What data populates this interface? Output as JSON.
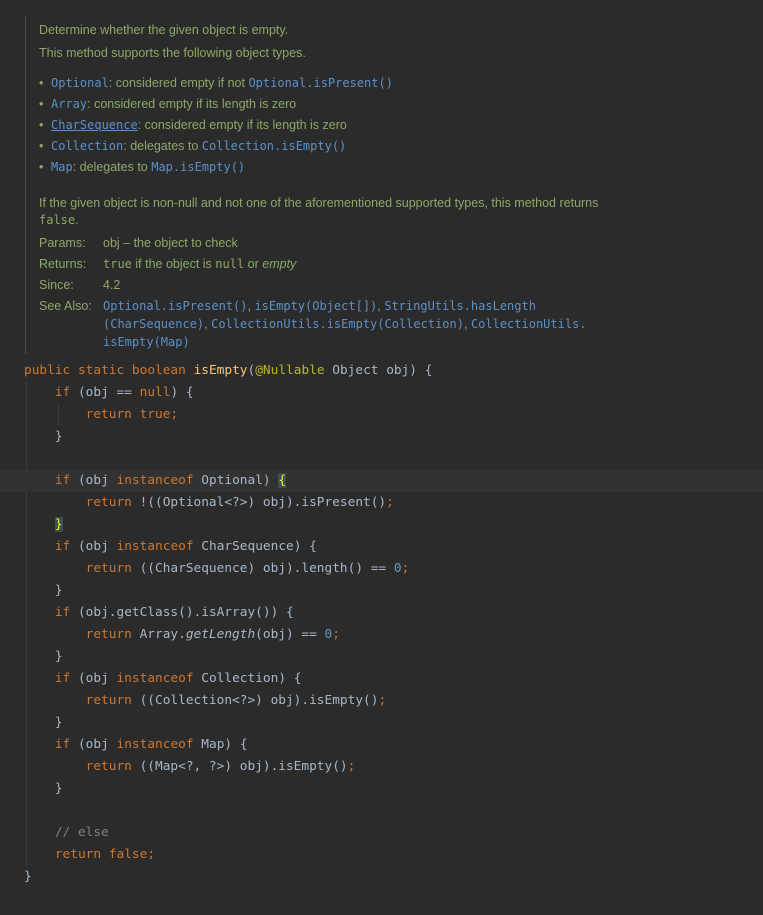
{
  "doc": {
    "intro": "Determine whether the given object is empty.",
    "supports": "This method supports the following object types.",
    "bullets": [
      {
        "type": "Optional",
        "text": ": considered empty if not ",
        "ref": "Optional.isPresent()"
      },
      {
        "type": "Array",
        "text": ": considered empty if its length is zero",
        "ref": ""
      },
      {
        "type": "CharSequence",
        "text": ": considered empty if its length is zero",
        "ref": ""
      },
      {
        "type": "Collection",
        "text": ": delegates to ",
        "ref": "Collection.isEmpty()"
      },
      {
        "type": "Map",
        "text": ": delegates to ",
        "ref": "Map.isEmpty()"
      }
    ],
    "note": "If the given object is non-null and not one of the aforementioned supported types, this method returns",
    "note_false": "false",
    "note_end": ".",
    "params_label": "Params:",
    "params_value": "obj – the object to check",
    "returns_label": "Returns:",
    "returns_true": "true",
    "returns_mid": " if the object is ",
    "returns_null": "null",
    "returns_or": " or ",
    "returns_empty": "empty",
    "since_label": "Since:",
    "since_value": "4.2",
    "see_label": "See Also:",
    "see_refs": [
      "Optional.isPresent()",
      ", ",
      "isEmpty(Object[])",
      ", ",
      "StringUtils.hasLength",
      "(CharSequence)",
      ", ",
      "CollectionUtils.isEmpty(Collection)",
      ", ",
      "CollectionUtils.",
      "isEmpty(Map)"
    ]
  },
  "code": {
    "sig_public": "public",
    "sig_static": "static",
    "sig_boolean": "boolean",
    "sig_name": "isEmpty",
    "sig_annotation": "@Nullable",
    "sig_params": " Object obj) {",
    "obj": "obj",
    "kw_if": "if",
    "kw_return": "return",
    "kw_null": "null",
    "kw_true": "true",
    "kw_false": "false",
    "kw_instanceof": "instanceof",
    "type_optional": "Optional",
    "type_charseq": "CharSequence",
    "type_collection": "Collection",
    "type_map": "Map",
    "l_optional_ret": "!((Optional<?>) obj).isPresent()",
    "l_charseq_ret": "((CharSequence) obj).length() == ",
    "l_array_cond": "(obj.getClass().isArray()) {",
    "l_array_pre": "Array.",
    "l_array_fn": "getLength",
    "l_array_post": "(obj) == ",
    "l_collection_ret": "((Collection<?>) obj).isEmpty()",
    "l_map_ret": "((Map<?, ?>) obj).isEmpty()",
    "zero": "0",
    "comment": "// else"
  }
}
